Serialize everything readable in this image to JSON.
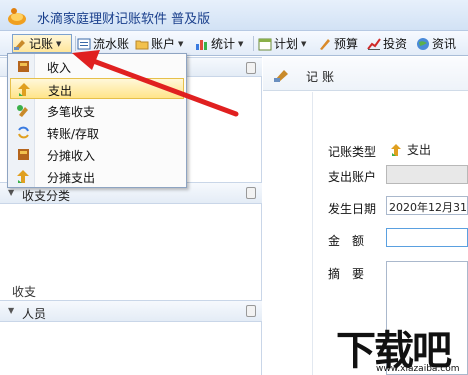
{
  "window": {
    "title": "水滴家庭理财记账软件 普及版"
  },
  "toolbar": {
    "items": [
      {
        "label": "记账",
        "icon": "ledger-icon"
      },
      {
        "label": "流水账",
        "icon": "list-icon"
      },
      {
        "label": "账户",
        "icon": "folder-icon"
      },
      {
        "label": "统计",
        "icon": "bar-chart-icon"
      },
      {
        "label": "计划",
        "icon": "calendar-icon"
      },
      {
        "label": "预算",
        "icon": "pencil-icon"
      },
      {
        "label": "投资",
        "icon": "trend-icon"
      },
      {
        "label": "资讯",
        "icon": "globe-icon"
      }
    ]
  },
  "menu": {
    "items": [
      {
        "label": "收入",
        "icon": "income-book-icon"
      },
      {
        "label": "支出",
        "icon": "expense-arrow-icon",
        "highlighted": true
      },
      {
        "label": "多笔收支",
        "icon": "multi-entry-icon"
      },
      {
        "label": "转账/存取",
        "icon": "transfer-icon"
      },
      {
        "label": "分摊收入",
        "icon": "split-income-icon"
      },
      {
        "label": "分摊支出",
        "icon": "split-expense-icon"
      }
    ]
  },
  "left_panel": {
    "category_header": "收支分类",
    "category_list_label": "收支",
    "people_header": "人员"
  },
  "form": {
    "header": "记账",
    "type_label": "记账类型",
    "type_value": "支出",
    "account_label": "支出账户",
    "date_label": "发生日期",
    "date_value": "2020年12月31日",
    "amount_label": "金　额",
    "memo_label": "摘　要"
  },
  "watermark": {
    "big": "下载吧",
    "small": "www.xiazaiba.com"
  },
  "colors": {
    "accent": "#e02020",
    "menu_highlight": "#ffe58a",
    "titlebar": "#d2e2f5"
  }
}
